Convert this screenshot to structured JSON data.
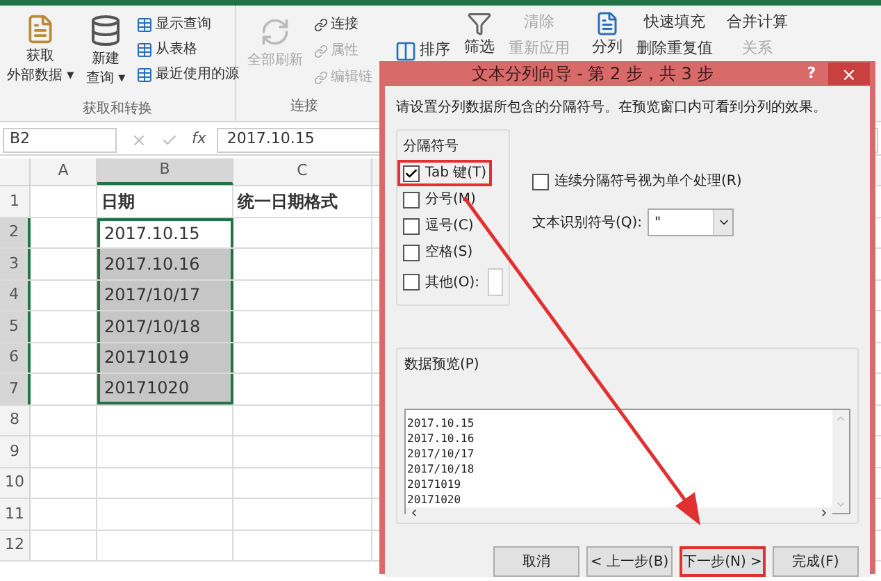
{
  "ribbon": {
    "caret": "▾",
    "get_external": [
      "获取",
      "外部数据"
    ],
    "new_query": [
      "新建",
      "查询"
    ],
    "query_items": [
      "显示查询",
      "从表格",
      "最近使用的源"
    ],
    "group1": "获取和转换",
    "refresh_all": "全部刷新",
    "conn_items": [
      {
        "label": "连接",
        "disabled": false
      },
      {
        "label": "属性",
        "disabled": true
      },
      {
        "label": "编辑链",
        "disabled": true
      }
    ],
    "group2": "连接",
    "sort": "排序",
    "filter": "筛选",
    "filter_items": [
      {
        "label": "清除",
        "disabled": true
      },
      {
        "label": "重新应用",
        "disabled": true
      }
    ],
    "split": "分列",
    "tool_items": [
      "快速填充",
      "删除重复值"
    ],
    "tool_items2": [
      {
        "label": "合并计算",
        "disabled": false
      },
      {
        "label": "关系",
        "disabled": true
      }
    ]
  },
  "formula_bar": {
    "name_box": "B2",
    "fx": "fx",
    "value": "2017.10.15"
  },
  "sheet": {
    "columns": [
      "A",
      "B",
      "C"
    ],
    "rows": [
      {
        "number": "1",
        "selected": false,
        "in_range": false,
        "active": false,
        "kind": "header",
        "b": "日期",
        "c": "统一日期格式"
      },
      {
        "number": "2",
        "selected": true,
        "in_range": true,
        "active": true,
        "kind": "data",
        "b": "2017.10.15"
      },
      {
        "number": "3",
        "selected": true,
        "in_range": true,
        "active": false,
        "kind": "data",
        "b": "2017.10.16"
      },
      {
        "number": "4",
        "selected": true,
        "in_range": true,
        "active": false,
        "kind": "data",
        "b": "2017/10/17"
      },
      {
        "number": "5",
        "selected": true,
        "in_range": true,
        "active": false,
        "kind": "data",
        "b": "2017/10/18"
      },
      {
        "number": "6",
        "selected": true,
        "in_range": true,
        "active": false,
        "kind": "data",
        "b": "20171019"
      },
      {
        "number": "7",
        "selected": true,
        "in_range": true,
        "active": false,
        "kind": "data",
        "b": "20171020"
      },
      {
        "number": "8",
        "selected": false,
        "in_range": false,
        "active": false,
        "kind": "data"
      },
      {
        "number": "9",
        "selected": false,
        "in_range": false,
        "active": false,
        "kind": "data"
      },
      {
        "number": "10",
        "selected": false,
        "in_range": false,
        "active": false,
        "kind": "data"
      },
      {
        "number": "11",
        "selected": false,
        "in_range": false,
        "active": false,
        "kind": "data"
      },
      {
        "number": "12",
        "selected": false,
        "in_range": false,
        "active": false,
        "kind": "data"
      }
    ]
  },
  "dialog": {
    "title": "文本分列向导 - 第 2 步，共 3 步",
    "help": "?",
    "close": "×",
    "description": "请设置分列数据所包含的分隔符号。在预览窗口内可看到分列的效果。",
    "delimiters_label": "分隔符号",
    "delimiters": [
      {
        "kind": "plain",
        "label": "Tab 键(T)",
        "checked": true,
        "highlighted": true
      },
      {
        "kind": "plain",
        "label": "分号(M)",
        "checked": false,
        "highlighted": false
      },
      {
        "kind": "plain",
        "label": "逗号(C)",
        "checked": false,
        "highlighted": false
      },
      {
        "kind": "plain",
        "label": "空格(S)",
        "checked": false,
        "highlighted": false
      },
      {
        "kind": "other",
        "label": "其他(O):",
        "checked": false,
        "highlighted": false
      }
    ],
    "consecutive": {
      "label": "连续分隔符号视为单个处理(R)",
      "checked": false
    },
    "qualifier": {
      "label": "文本识别符号(Q):",
      "value": "\""
    },
    "preview_label": "数据预览(P)",
    "preview_lines": [
      "2017.10.15",
      "2017.10.16",
      "2017/10/17",
      "2017/10/18",
      "20171019",
      "20171020"
    ],
    "buttons": [
      {
        "label": "取消",
        "highlighted": false
      },
      {
        "label": "< 上一步(B)",
        "highlighted": false
      },
      {
        "label": "下一步(N) >",
        "highlighted": true
      },
      {
        "label": "完成(F)",
        "highlighted": false
      }
    ]
  }
}
